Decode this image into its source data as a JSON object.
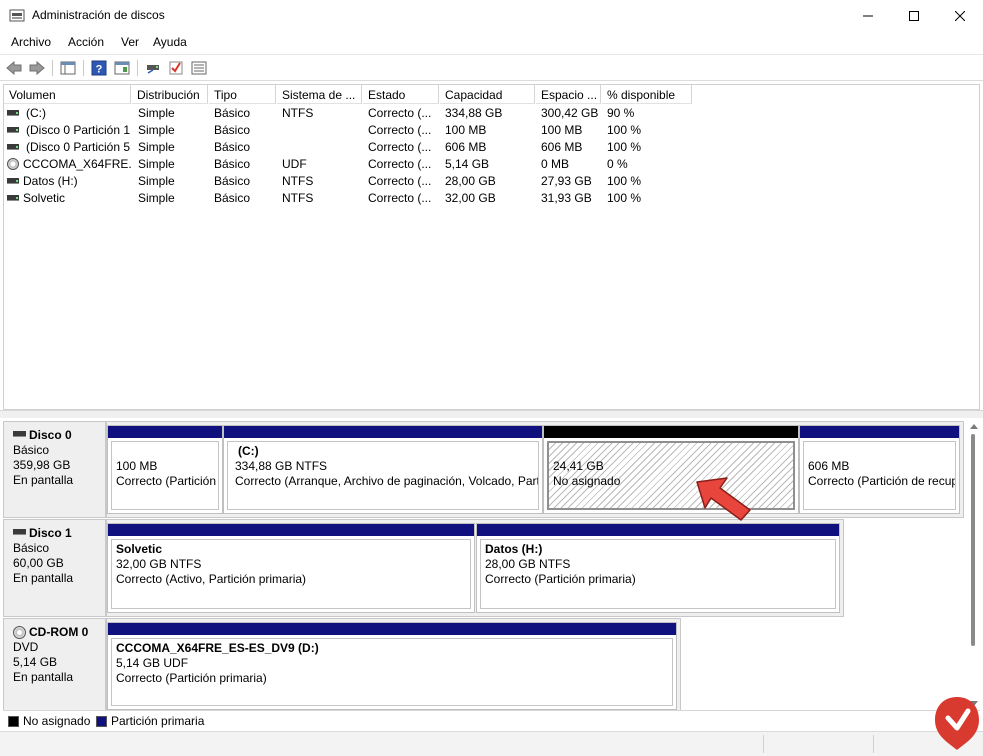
{
  "window": {
    "title": "Administración de discos",
    "min_icon": "minimize-icon",
    "max_icon": "maximize-icon",
    "close_icon": "close-icon"
  },
  "menu": {
    "items": [
      "Archivo",
      "Acción",
      "Ver",
      "Ayuda"
    ]
  },
  "toolbar": {
    "icons": [
      "back-arrow-icon",
      "forward-arrow-icon",
      "console-tree-icon",
      "help-icon",
      "show-pane-icon",
      "connect-disk-icon",
      "check-icon",
      "properties-list-icon"
    ]
  },
  "volume_list": {
    "columns": [
      "Volumen",
      "Distribución",
      "Tipo",
      "Sistema de ...",
      "Estado",
      "Capacidad",
      "Espacio ...",
      "% disponible"
    ],
    "rows": [
      {
        "icon": "drive",
        "volumen": "(C:)",
        "distribucion": "Simple",
        "tipo": "Básico",
        "sistema": "NTFS",
        "estado": "Correcto (...",
        "capacidad": "334,88 GB",
        "espacio": "300,42 GB",
        "disponible": "90 %"
      },
      {
        "icon": "drive",
        "volumen": "(Disco 0 Partición 1)",
        "distribucion": "Simple",
        "tipo": "Básico",
        "sistema": "",
        "estado": "Correcto (...",
        "capacidad": "100 MB",
        "espacio": "100 MB",
        "disponible": "100 %"
      },
      {
        "icon": "drive",
        "volumen": "(Disco 0 Partición 5)",
        "distribucion": "Simple",
        "tipo": "Básico",
        "sistema": "",
        "estado": "Correcto (...",
        "capacidad": "606 MB",
        "espacio": "606 MB",
        "disponible": "100 %"
      },
      {
        "icon": "cd",
        "volumen": "CCCOMA_X64FRE...",
        "distribucion": "Simple",
        "tipo": "Básico",
        "sistema": "UDF",
        "estado": "Correcto (...",
        "capacidad": "5,14 GB",
        "espacio": "0 MB",
        "disponible": "0 %"
      },
      {
        "icon": "drive",
        "volumen": "Datos (H:)",
        "distribucion": "Simple",
        "tipo": "Básico",
        "sistema": "NTFS",
        "estado": "Correcto (...",
        "capacidad": "28,00 GB",
        "espacio": "27,93 GB",
        "disponible": "100 %"
      },
      {
        "icon": "drive",
        "volumen": "Solvetic",
        "distribucion": "Simple",
        "tipo": "Básico",
        "sistema": "NTFS",
        "estado": "Correcto (...",
        "capacidad": "32,00 GB",
        "espacio": "31,93 GB",
        "disponible": "100 %"
      }
    ]
  },
  "disks": [
    {
      "name": "Disco 0",
      "type": "Básico",
      "size": "359,98 GB",
      "status": "En pantalla",
      "partitions": [
        {
          "title": "",
          "size": "100 MB",
          "desc": "Correcto (Partición"
        },
        {
          "title": "(C:)",
          "size": "334,88 GB NTFS",
          "desc": "Correcto (Arranque, Archivo de paginación, Volcado, Parti"
        },
        {
          "title": "",
          "size": "24,41 GB",
          "desc": "No asignado"
        },
        {
          "title": "",
          "size": "606 MB",
          "desc": "Correcto (Partición de recup"
        }
      ]
    },
    {
      "name": "Disco 1",
      "type": "Básico",
      "size": "60,00 GB",
      "status": "En pantalla",
      "partitions": [
        {
          "title": "Solvetic",
          "size": "32,00 GB NTFS",
          "desc": "Correcto (Activo, Partición primaria)"
        },
        {
          "title": "Datos  (H:)",
          "size": "28,00 GB NTFS",
          "desc": "Correcto (Partición primaria)"
        }
      ]
    },
    {
      "name": "CD-ROM 0",
      "type": "DVD",
      "size": "5,14 GB",
      "status": "En pantalla",
      "partitions": [
        {
          "title": "CCCOMA_X64FRE_ES-ES_DV9  (D:)",
          "size": "5,14 GB UDF",
          "desc": "Correcto (Partición primaria)"
        }
      ]
    }
  ],
  "legend": {
    "unallocated": "No asignado",
    "primary": "Partición primaria",
    "unallocated_color": "#000000",
    "primary_color": "#10107f"
  },
  "annotations": {
    "arrow_icon": "red-pointer-arrow-icon",
    "arrow_color": "#e8453c",
    "logo_icon": "solvetic-logo-icon"
  }
}
